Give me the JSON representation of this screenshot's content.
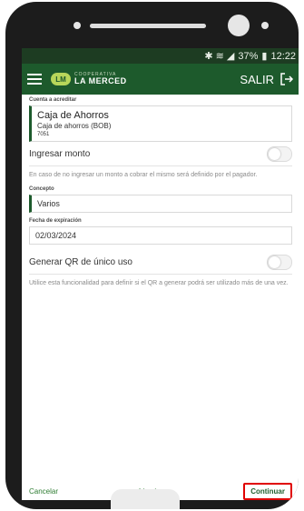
{
  "status_bar": {
    "icons": "✱ ≋ ◢",
    "battery": "37%",
    "time": "12:22"
  },
  "app_bar": {
    "menu_icon": "hamburger-icon",
    "logo_mark": "LM",
    "logo_small": "COOPERATIVA",
    "logo_name": "LA MERCED",
    "logout_label": "SALIR",
    "logout_icon": "logout-icon"
  },
  "account": {
    "section_label": "Cuenta a acreditar",
    "name": "Caja de Ahorros",
    "type": "Caja de ahorros (BOB)",
    "number": "7051"
  },
  "amount": {
    "label": "Ingresar monto",
    "enabled": false,
    "hint": "En caso de no ingresar un monto a cobrar el mismo será definido por el pagador."
  },
  "concept": {
    "label": "Concepto",
    "value": "Varios"
  },
  "expiration": {
    "label": "Fecha de expiración",
    "value": "02/03/2024"
  },
  "single_use": {
    "label": "Generar QR de único uso",
    "enabled": false,
    "hint": "Utilice esta funcionalidad para definir si el QR a generar podrá ser utilizado más de una vez."
  },
  "bottom_bar": {
    "cancel": "Cancelar",
    "clear": "Limpiar",
    "continue": "Continuar"
  },
  "colors": {
    "brand_green": "#1d5a2c",
    "highlight": "#e00000"
  }
}
